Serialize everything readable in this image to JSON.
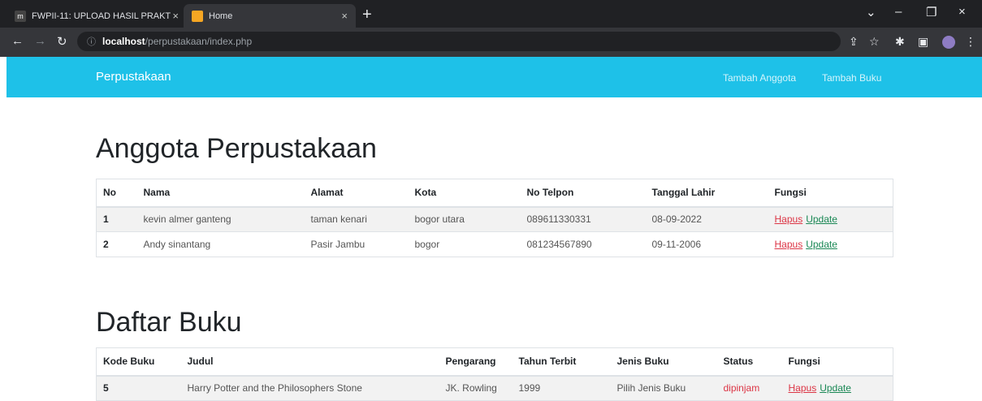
{
  "browser": {
    "tabs": [
      {
        "title": "FWPII-11: UPLOAD HASIL PRAKT",
        "active": false
      },
      {
        "title": "Home",
        "active": true
      }
    ],
    "new_tab": "+",
    "url_host": "localhost",
    "url_path": "/perpustakaan/index.php"
  },
  "navbar": {
    "brand": "Perpustakaan",
    "links": [
      "Tambah Anggota",
      "Tambah Buku"
    ]
  },
  "members": {
    "heading": "Anggota Perpustakaan",
    "columns": [
      "No",
      "Nama",
      "Alamat",
      "Kota",
      "No Telpon",
      "Tanggal Lahir",
      "Fungsi"
    ],
    "rows": [
      {
        "no": "1",
        "nama": "kevin almer ganteng",
        "alamat": "taman kenari",
        "kota": "bogor utara",
        "telpon": "089611330331",
        "lahir": "08-09-2022"
      },
      {
        "no": "2",
        "nama": "Andy sinantang",
        "alamat": "Pasir Jambu",
        "kota": "bogor",
        "telpon": "081234567890",
        "lahir": "09-11-2006"
      }
    ],
    "delete_label": "Hapus",
    "update_label": "Update"
  },
  "books": {
    "heading": "Daftar Buku",
    "columns": [
      "Kode Buku",
      "Judul",
      "Pengarang",
      "Tahun Terbit",
      "Jenis Buku",
      "Status",
      "Fungsi"
    ],
    "rows": [
      {
        "kode": "5",
        "judul": "Harry Potter and the Philosophers Stone",
        "pengarang": "JK. Rowling",
        "tahun": "1999",
        "jenis": "Pilih Jenis Buku",
        "status": "dipinjam"
      }
    ],
    "delete_label": "Hapus",
    "update_label": "Update"
  }
}
